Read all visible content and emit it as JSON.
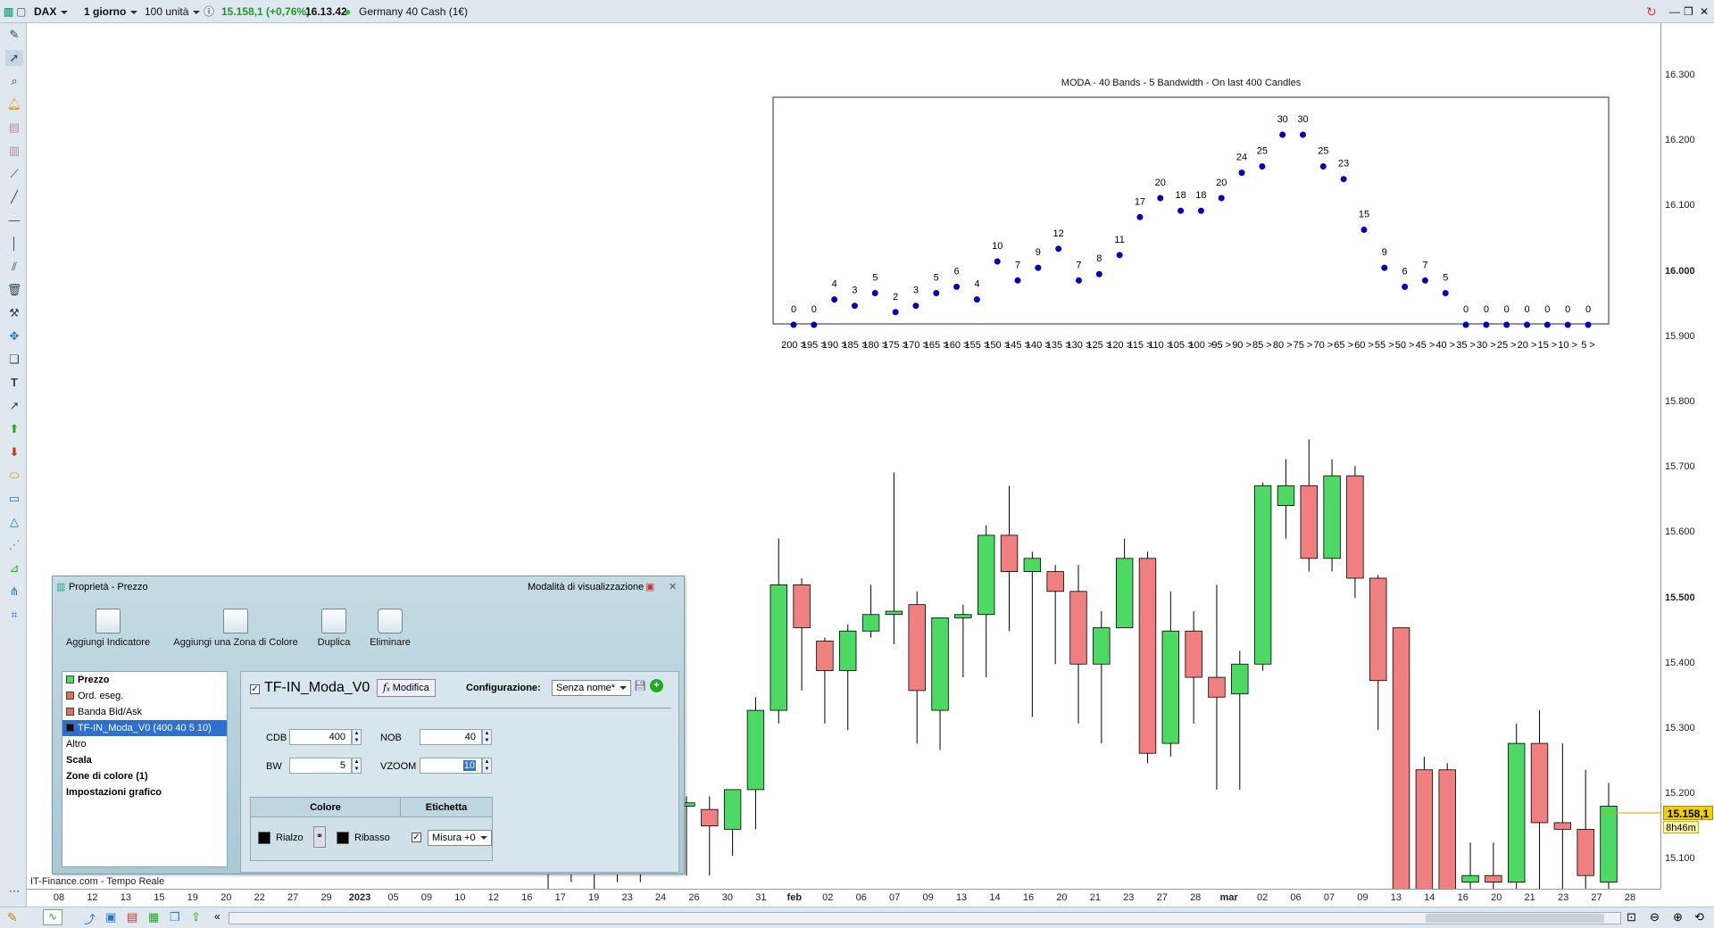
{
  "topbar": {
    "symbol": "DAX",
    "timeframe": "1 giorno",
    "units": "100 unità",
    "price_change": "15.158,1 (+0,76%)",
    "time": "16.13.42",
    "instrument": "Germany 40 Cash (1€)"
  },
  "footer": {
    "source": "IT-Finance.com - Tempo Reale"
  },
  "yaxis": {
    "ticks": [
      "16.300",
      "16.200",
      "16.100",
      "16.000",
      "15.900",
      "15.800",
      "15.700",
      "15.600",
      "15.500",
      "15.400",
      "15.300",
      "15.200",
      "15.100"
    ],
    "bold": [
      "16.000",
      "15.500"
    ],
    "last_price": "15.158,1",
    "countdown": "8h46m"
  },
  "xaxis": {
    "ticks": [
      "08",
      "12",
      "13",
      "15",
      "19",
      "20",
      "22",
      "27",
      "29",
      "2023",
      "05",
      "09",
      "10",
      "12",
      "16",
      "17",
      "19",
      "23",
      "24",
      "26",
      "30",
      "31",
      "feb",
      "02",
      "06",
      "07",
      "09",
      "13",
      "14",
      "16",
      "20",
      "21",
      "23",
      "27",
      "28",
      "mar",
      "02",
      "06",
      "07",
      "09",
      "13",
      "14",
      "16",
      "20",
      "21",
      "23",
      "27",
      "28"
    ],
    "bold": [
      "2023",
      "feb",
      "mar"
    ]
  },
  "moda": {
    "title": "MODA - 40 Bands - 5 Bandwidth - On last 400 Candles",
    "counts": [
      0,
      0,
      4,
      3,
      5,
      2,
      3,
      5,
      6,
      4,
      10,
      7,
      9,
      12,
      7,
      8,
      11,
      17,
      20,
      18,
      18,
      20,
      24,
      25,
      30,
      30,
      25,
      23,
      15,
      9,
      6,
      7,
      5,
      0,
      0,
      0,
      0,
      0,
      0,
      0
    ],
    "bands": [
      "200 >",
      "195 >",
      "190 >",
      "185 >",
      "180 >",
      "175 >",
      "170 >",
      "165 >",
      "160 >",
      "155 >",
      "150 >",
      "145 >",
      "140 >",
      "135 >",
      "130 >",
      "125 >",
      "120 >",
      "115 >",
      "110 >",
      "105 >",
      "100 >",
      "95 >",
      "90 >",
      "85 >",
      "80 >",
      "75 >",
      "70 >",
      "65 >",
      "60 >",
      "55 >",
      "50 >",
      "45 >",
      "40 >",
      "35 >",
      "30 >",
      "25 >",
      "20 >",
      "15 >",
      "10 >",
      "5 >"
    ],
    "dot_color": "#0000b4"
  },
  "chart_data": {
    "type": "candlestick",
    "up_color": "#4cd964",
    "down_color": "#f08080",
    "ylim": [
      15030,
      16340
    ],
    "candles": [
      {
        "o": 15140,
        "h": 15140,
        "c": 15090,
        "l": 15020
      },
      {
        "o": 15130,
        "h": 15140,
        "c": 15090,
        "l": 15040
      },
      {
        "o": 15080,
        "h": 15140,
        "c": 15130,
        "l": 15030
      },
      {
        "o": 15130,
        "h": 15150,
        "c": 15120,
        "l": 15040
      },
      {
        "o": 15130,
        "h": 15150,
        "c": 15140,
        "l": 15040
      },
      {
        "o": 15140,
        "h": 15190,
        "c": 15155,
        "l": 15070
      },
      {
        "o": 15155,
        "h": 15170,
        "c": 15160,
        "l": 15050
      },
      {
        "o": 15150,
        "h": 15170,
        "c": 15125,
        "l": 15050
      },
      {
        "o": 15120,
        "h": 15180,
        "c": 15180,
        "l": 15080
      },
      {
        "o": 15180,
        "h": 15320,
        "c": 15300,
        "l": 15120
      },
      {
        "o": 15300,
        "h": 15560,
        "c": 15490,
        "l": 15280
      },
      {
        "o": 15490,
        "h": 15500,
        "c": 15425,
        "l": 15330
      },
      {
        "o": 15405,
        "h": 15410,
        "c": 15360,
        "l": 15280
      },
      {
        "o": 15360,
        "h": 15430,
        "c": 15420,
        "l": 15270
      },
      {
        "o": 15420,
        "h": 15490,
        "c": 15445,
        "l": 15410
      },
      {
        "o": 15445,
        "h": 15660,
        "c": 15450,
        "l": 15400
      },
      {
        "o": 15460,
        "h": 15480,
        "c": 15330,
        "l": 15250
      },
      {
        "o": 15300,
        "h": 15440,
        "c": 15440,
        "l": 15240
      },
      {
        "o": 15440,
        "h": 15460,
        "c": 15445,
        "l": 15350
      },
      {
        "o": 15445,
        "h": 15580,
        "c": 15565,
        "l": 15350
      },
      {
        "o": 15565,
        "h": 15640,
        "c": 15510,
        "l": 15420
      },
      {
        "o": 15510,
        "h": 15540,
        "c": 15530,
        "l": 15290
      },
      {
        "o": 15510,
        "h": 15520,
        "c": 15480,
        "l": 15370
      },
      {
        "o": 15480,
        "h": 15520,
        "c": 15370,
        "l": 15280
      },
      {
        "o": 15370,
        "h": 15450,
        "c": 15425,
        "l": 15250
      },
      {
        "o": 15425,
        "h": 15560,
        "c": 15530,
        "l": 15430
      },
      {
        "o": 15530,
        "h": 15540,
        "c": 15235,
        "l": 15220
      },
      {
        "o": 15250,
        "h": 15480,
        "c": 15420,
        "l": 15230
      },
      {
        "o": 15420,
        "h": 15450,
        "c": 15350,
        "l": 15280
      },
      {
        "o": 15350,
        "h": 15490,
        "c": 15320,
        "l": 15180
      },
      {
        "o": 15325,
        "h": 15390,
        "c": 15370,
        "l": 15180
      },
      {
        "o": 15370,
        "h": 15645,
        "c": 15640,
        "l": 15360
      },
      {
        "o": 15610,
        "h": 15680,
        "c": 15640,
        "l": 15560
      },
      {
        "o": 15640,
        "h": 15710,
        "c": 15530,
        "l": 15510
      },
      {
        "o": 15530,
        "h": 15680,
        "c": 15655,
        "l": 15510
      },
      {
        "o": 15655,
        "h": 15670,
        "c": 15500,
        "l": 15470
      },
      {
        "o": 15500,
        "h": 15505,
        "c": 15345,
        "l": 15270
      },
      {
        "o": 15425,
        "h": 15425,
        "c": 15020,
        "l": 15020
      },
      {
        "o": 15210,
        "h": 15230,
        "c": 15020,
        "l": 15020
      },
      {
        "o": 15210,
        "h": 15220,
        "c": 15020,
        "l": 15020
      },
      {
        "o": 15040,
        "h": 15100,
        "c": 15050,
        "l": 15020
      },
      {
        "o": 15050,
        "h": 15100,
        "c": 15040,
        "l": 15020
      },
      {
        "o": 15040,
        "h": 15280,
        "c": 15250,
        "l": 15020
      },
      {
        "o": 15250,
        "h": 15300,
        "c": 15130,
        "l": 15020
      },
      {
        "o": 15130,
        "h": 15250,
        "c": 15120,
        "l": 15020
      },
      {
        "o": 15120,
        "h": 15210,
        "c": 15050,
        "l": 15020
      },
      {
        "o": 15040,
        "h": 15190,
        "c": 15155,
        "l": 15020
      }
    ]
  },
  "dialog": {
    "title": "Proprietà - Prezzo",
    "mode": "Modalità di visualizzazione",
    "toolbar": [
      "Aggiungi Indicatore",
      "Aggiungi una Zona di Colore",
      "Duplica",
      "Eliminare"
    ],
    "list": [
      {
        "label": "Prezzo",
        "bold": true,
        "swatch": "#4cd964"
      },
      {
        "label": "Ord. eseg.",
        "swatch": "#e07050"
      },
      {
        "label": "Banda Bid/Ask",
        "swatch": "#e07050"
      },
      {
        "label": "TF-IN_Moda_V0 (400 40 5 10)",
        "selected": true,
        "swatch": "#111111"
      },
      {
        "label": "Altro"
      },
      {
        "label": "Scala",
        "bold": true
      },
      {
        "label": "Zone di colore (1)",
        "bold": true
      },
      {
        "label": "Impostazioni grafico",
        "bold": true
      }
    ],
    "indicator": "TF-IN_Moda_V0",
    "modify": "Modifica",
    "config_label": "Configurazione:",
    "config_value": "Senza nome*",
    "cdb_label": "CDB",
    "cdb": "400",
    "nob_label": "NOB",
    "nob": "40",
    "bw_label": "BW",
    "bw": "5",
    "vzoom_label": "VZOOM",
    "vzoom": "10",
    "colore": "Colore",
    "etichetta": "Etichetta",
    "rialzo": "Rialzo",
    "ribasso": "Ribasso",
    "misura": "Misura +0"
  }
}
